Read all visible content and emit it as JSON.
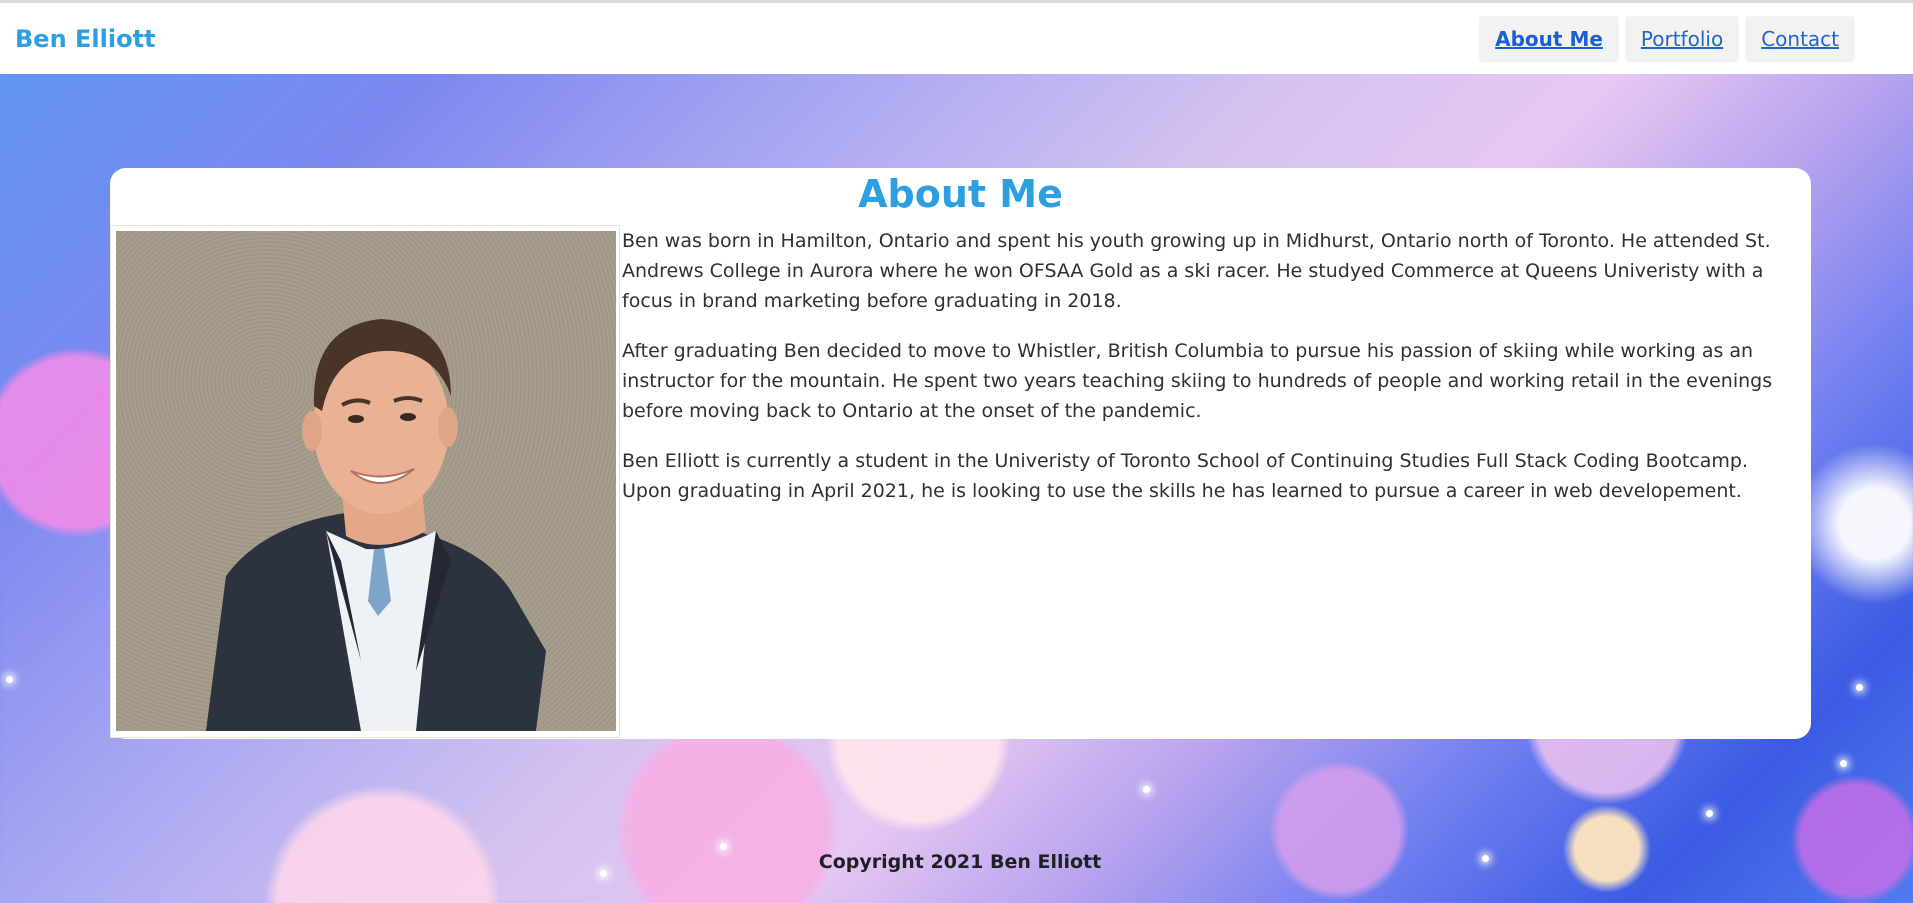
{
  "header": {
    "brand": "Ben Elliott",
    "nav": [
      {
        "label": "About Me",
        "active": true
      },
      {
        "label": "Portfolio",
        "active": false
      },
      {
        "label": "Contact",
        "active": false
      }
    ]
  },
  "about": {
    "title": "About Me",
    "photo_alt": "Portrait of Ben Elliott",
    "paragraphs": [
      "Ben was born in Hamilton, Ontario and spent his youth growing up in Midhurst, Ontario north of Toronto. He attended St. Andrews College in Aurora where he won OFSAA Gold as a ski racer. He studyed Commerce at Queens Univeristy with a focus in brand marketing before graduating in 2018.",
      "After graduating Ben decided to move to Whistler, British Columbia to pursue his passion of skiing while working as an instructor for the mountain. He spent two years teaching skiing to hundreds of people and working retail in the evenings before moving back to Ontario at the onset of the pandemic.",
      "Ben Elliott is currently a student in the Univeristy of Toronto School of Continuing Studies Full Stack Coding Bootcamp. Upon graduating in April 2021, he is looking to use the skills he has learned to pursue a career in web developement."
    ]
  },
  "footer": {
    "copyright": "Copyright 2021 Ben Elliott"
  },
  "colors": {
    "accent": "#2b9fe0",
    "link": "#1f67c9",
    "text": "#2e3035"
  }
}
